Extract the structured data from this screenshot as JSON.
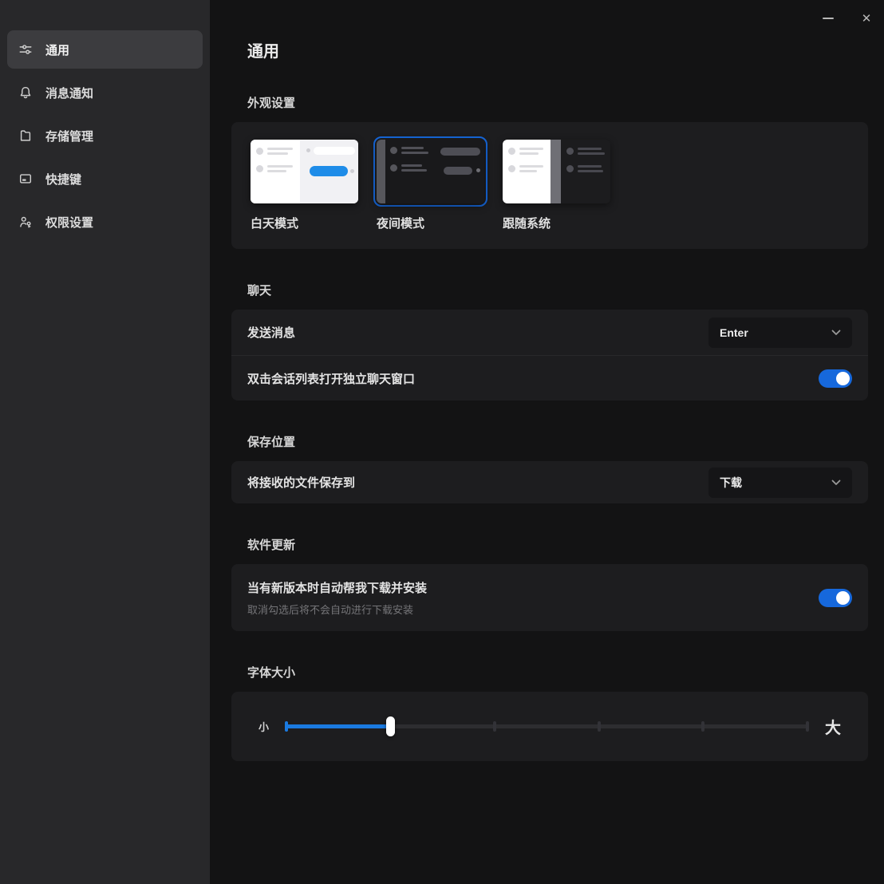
{
  "window": {
    "minimize_glyph": "—",
    "close_glyph": "✕"
  },
  "sidebar": {
    "items": [
      {
        "icon": "tune-icon",
        "label": "通用",
        "selected": true
      },
      {
        "icon": "bell-icon",
        "label": "消息通知",
        "selected": false
      },
      {
        "icon": "storage-icon",
        "label": "存储管理",
        "selected": false
      },
      {
        "icon": "hotkey-icon",
        "label": "快捷键",
        "selected": false
      },
      {
        "icon": "permission-icon",
        "label": "权限设置",
        "selected": false
      }
    ]
  },
  "main": {
    "title": "通用",
    "sections": {
      "appearance": {
        "heading": "外观设置",
        "options": [
          {
            "label": "白天模式",
            "selected": false
          },
          {
            "label": "夜间模式",
            "selected": true
          },
          {
            "label": "跟随系统",
            "selected": false
          }
        ]
      },
      "chat": {
        "heading": "聊天",
        "send": {
          "label": "发送消息",
          "value": "Enter"
        },
        "double_click": {
          "label": "双击会话列表打开独立聊天窗口",
          "enabled": true
        }
      },
      "save": {
        "heading": "保存位置",
        "row": {
          "label": "将接收的文件保存到",
          "value": "下载"
        }
      },
      "update": {
        "heading": "软件更新",
        "row": {
          "label": "当有新版本时自动帮我下载并安装",
          "description": "取消勾选后将不会自动进行下载安装",
          "enabled": true
        }
      },
      "font_size": {
        "heading": "字体大小",
        "min_label": "小",
        "max_label": "大",
        "value_percent": 20,
        "tick_percents": [
          0,
          20,
          40,
          60,
          80,
          100
        ]
      }
    }
  },
  "colors": {
    "accent": "#1668dc",
    "toggle-on": "#1668dc",
    "slider-fill": "#1a7ae0",
    "bubble-blue": "#1e8ce8"
  }
}
